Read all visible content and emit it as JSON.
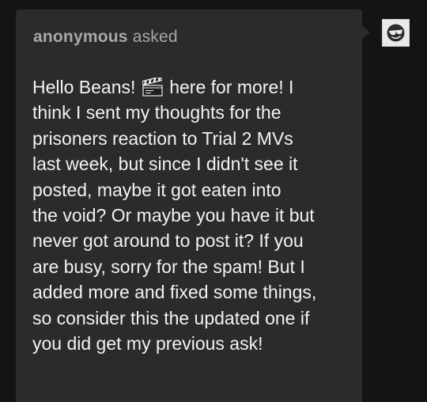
{
  "ask": {
    "asker_name": "anonymous",
    "asked_label": "asked",
    "body_lines": [
      {
        "before": "Hello Beans! ",
        "icon": "clapper-board-icon",
        "after": " here for more! I"
      },
      {
        "text": "think I sent my thoughts for the"
      },
      {
        "text": "prisoners reaction to Trial 2 MVs"
      },
      {
        "text": "last week, but since I didn't see it"
      },
      {
        "text": "posted, maybe it got eaten into"
      },
      {
        "text": "the void? Or maybe you have it but"
      },
      {
        "text": "never got around to post it? If you"
      },
      {
        "text": "are busy, sorry for the spam! But I"
      },
      {
        "text": "added more and fixed some things,"
      },
      {
        "text": "so consider this the updated one if"
      },
      {
        "text": "you did get my previous ask!"
      }
    ]
  },
  "colors": {
    "page_background": "#141414",
    "bubble_background": "#2b2b2b",
    "asker_text": "#a8a8a8",
    "body_text": "#f2f2f2"
  },
  "avatar": {
    "icon": "cool-sunglasses-emoji-icon"
  }
}
